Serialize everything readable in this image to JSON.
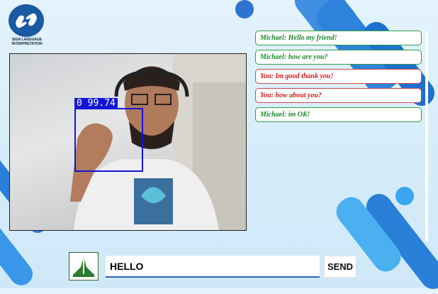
{
  "app": {
    "logo_text": "SIGN LANGUAGE INTERPRETATION"
  },
  "detection": {
    "label": "0 99.74"
  },
  "chat": {
    "messages": [
      {
        "text": "Michael: Hello my friend!",
        "sender": "Michael"
      },
      {
        "text": "Michael: how are you?",
        "sender": "Michael"
      },
      {
        "text": "You: Im good thank you!",
        "sender": "You"
      },
      {
        "text": "You: how about you?",
        "sender": "You"
      },
      {
        "text": "Michael: im OK!",
        "sender": "Michael"
      }
    ]
  },
  "composer": {
    "value": "HELLO",
    "send_label": "SEND",
    "app_icon": "sign-hands-icon"
  },
  "colors": {
    "michael": "#1a8a2e",
    "you": "#d11b1b",
    "accent": "#1a5aa0",
    "detection": "#1414d8"
  }
}
